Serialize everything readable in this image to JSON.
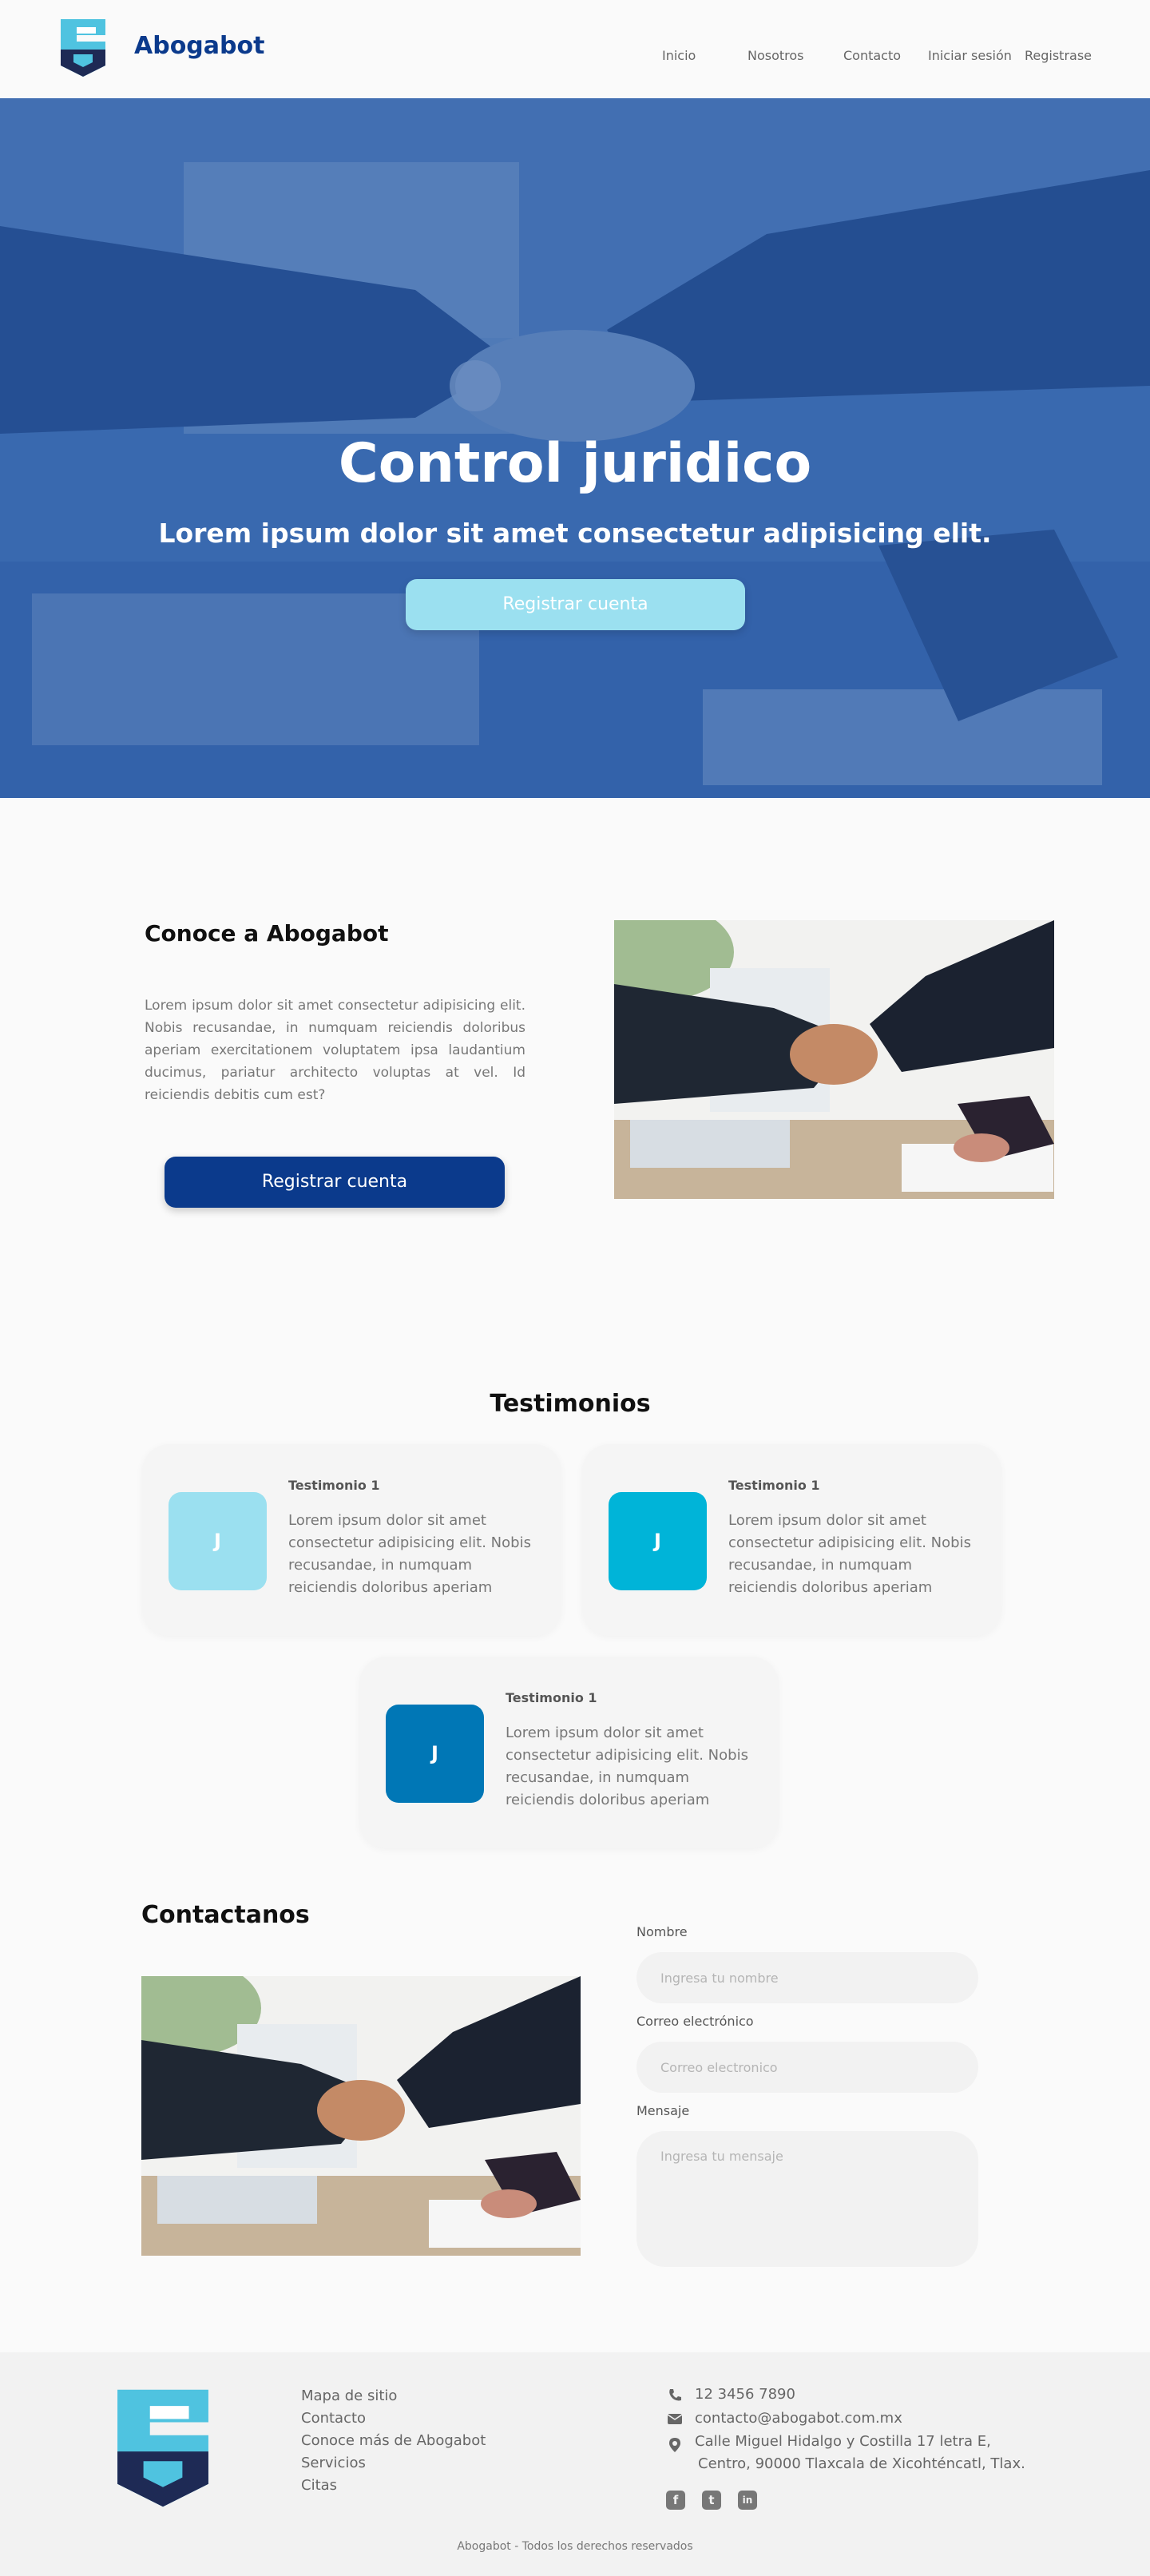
{
  "header": {
    "brand": "Abogabot",
    "nav": [
      "Inicio",
      "Nosotros",
      "Contacto",
      "Iniciar sesión",
      "Registrase"
    ]
  },
  "hero": {
    "title": "Control juridico",
    "subtitle": "Lorem ipsum dolor sit amet consectetur adipisicing elit.",
    "button": "Registrar cuenta"
  },
  "about": {
    "title": "Conoce a Abogabot",
    "text": "Lorem ipsum dolor sit amet consectetur adipisicing elit. Nobis recusandae, in numquam reiciendis doloribus aperiam exercitationem voluptatem ipsa laudantium ducimus, pariatur architecto voluptas at vel. Id reiciendis debitis cum est?",
    "button": "Registrar cuenta"
  },
  "testimonials": {
    "title": "Testimonios",
    "items": [
      {
        "initial": "J",
        "name": "Testimonio 1",
        "text": "Lorem ipsum dolor sit amet consectetur adipisicing elit. Nobis recusandae, in numquam reiciendis doloribus aperiam",
        "color": "#9be0f0"
      },
      {
        "initial": "J",
        "name": "Testimonio 1",
        "text": "Lorem ipsum dolor sit amet consectetur adipisicing elit. Nobis recusandae, in numquam reiciendis doloribus aperiam",
        "color": "#00b4d8"
      },
      {
        "initial": "J",
        "name": "Testimonio 1",
        "text": "Lorem ipsum dolor sit amet consectetur adipisicing elit. Nobis recusandae, in numquam reiciendis doloribus aperiam",
        "color": "#0077b6"
      }
    ]
  },
  "contact": {
    "title": "Contactanos",
    "name_label": "Nombre",
    "name_placeholder": "Ingresa tu nombre",
    "email_label": "Correo electrónico",
    "email_placeholder": "Correo electronico",
    "message_label": "Mensaje",
    "message_placeholder": "Ingresa tu mensaje"
  },
  "footer": {
    "links": [
      "Mapa de sitio",
      "Contacto",
      "Conoce más de Abogabot",
      "Servicios",
      "Citas"
    ],
    "phone": "12 3456 7890",
    "email": "contacto@abogabot.com.mx",
    "address_line1": "Calle Miguel Hidalgo y Costilla 17 letra E,",
    "address_line2": "Centro, 90000 Tlaxcala de Xicohténcatl, Tlax.",
    "social": [
      "facebook-icon",
      "twitter-icon",
      "linkedin-icon"
    ],
    "copyright": "Abogabot - Todos los derechos reservados"
  },
  "colors": {
    "brand_dark": "#0b3a8c",
    "accent_light": "#9be0f0",
    "accent_mid": "#00b4d8",
    "accent_deep": "#0077b6"
  }
}
